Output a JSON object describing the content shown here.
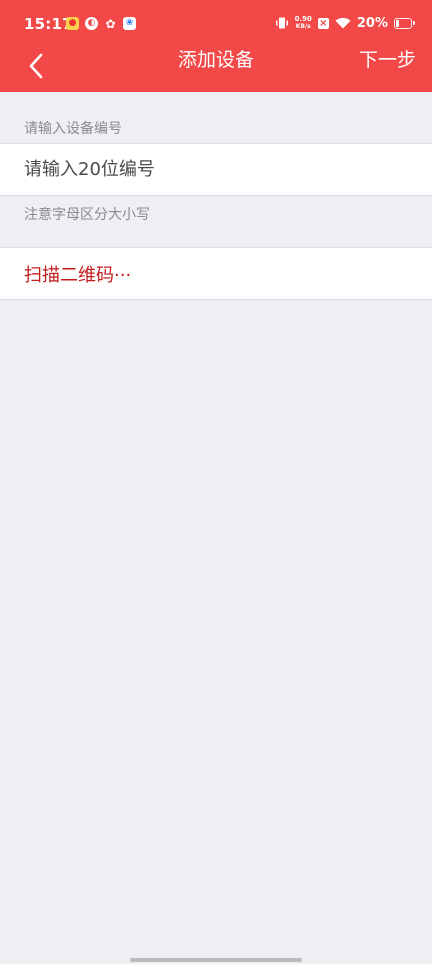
{
  "status_bar": {
    "time": "15:17",
    "net_speed_value": "0.90",
    "net_speed_unit": "KB/s",
    "battery_percent": "20%",
    "battery_level": 0.2
  },
  "nav": {
    "title": "添加设备",
    "next_label": "下一步"
  },
  "form": {
    "section_label": "请输入设备编号",
    "input_placeholder": "请输入20位编号",
    "input_value": "",
    "hint": "注意字母区分大小写"
  },
  "scan": {
    "label": "扫描二维码···"
  },
  "colors": {
    "header_bg": "#f24848",
    "scan_text": "#c21b1b",
    "page_bg": "#efeff3"
  }
}
